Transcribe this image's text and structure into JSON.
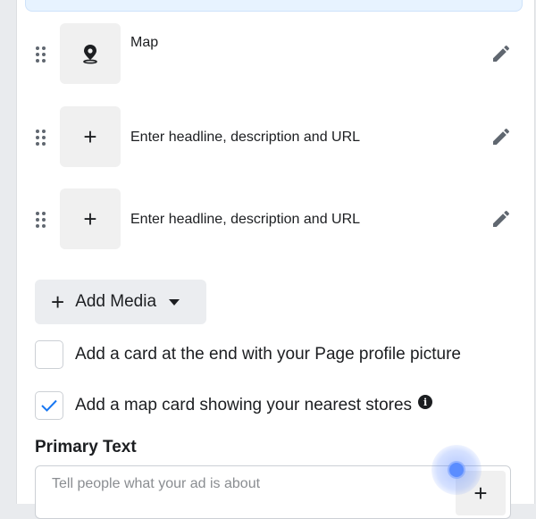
{
  "cards": [
    {
      "label": "Map",
      "thumb_icon": "map-pin-icon"
    },
    {
      "label": "Enter headline, description and URL",
      "thumb_icon": "plus-icon"
    },
    {
      "label": "Enter headline, description and URL",
      "thumb_icon": "plus-icon"
    }
  ],
  "add_media": {
    "label": "Add Media"
  },
  "options": [
    {
      "label": "Add a card at the end with your Page profile picture",
      "checked": false
    },
    {
      "label": "Add a map card showing your nearest stores",
      "checked": true
    }
  ],
  "primary_text": {
    "title": "Primary Text",
    "placeholder": "Tell people what your ad is about"
  },
  "colors": {
    "check_blue": "#1877f2",
    "cursor_blue": "#5b8dff",
    "top_strip": "#e7f3ff"
  }
}
